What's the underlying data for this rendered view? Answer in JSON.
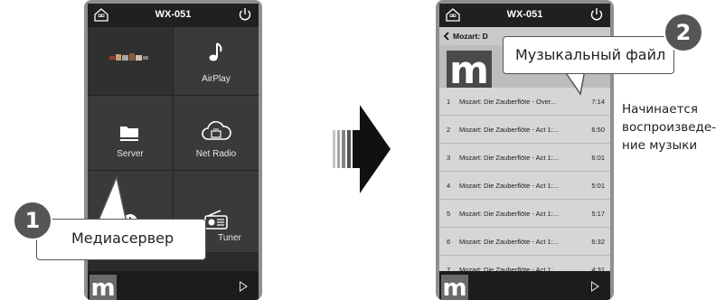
{
  "phone1": {
    "title": "WX-051",
    "home_label": "Rooms",
    "tiles": [
      {
        "label": ""
      },
      {
        "label": "AirPlay"
      },
      {
        "label": "Server"
      },
      {
        "label": "Net Radio"
      },
      {
        "label": ""
      },
      {
        "label": "Tuner"
      }
    ]
  },
  "phone2": {
    "title": "WX-051",
    "home_label": "Rooms",
    "back_label": "Mozart: D",
    "tracks": [
      {
        "num": "1",
        "title": "Mozart: Die Zauberflöte - Over...",
        "duration": "7:14"
      },
      {
        "num": "2",
        "title": "Mozart: Die Zauberflöte - Act 1:...",
        "duration": "6:50"
      },
      {
        "num": "3",
        "title": "Mozart: Die Zauberflöte - Act 1:...",
        "duration": "6:01"
      },
      {
        "num": "4",
        "title": "Mozart: Die Zauberflöte - Act 1:...",
        "duration": "5:01"
      },
      {
        "num": "5",
        "title": "Mozart: Die Zauberflöte - Act 1:...",
        "duration": "5:17"
      },
      {
        "num": "6",
        "title": "Mozart: Die Zauberflöte - Act 1:...",
        "duration": "6:32"
      },
      {
        "num": "7",
        "title": "Mozart: Die Zauberflöte - Act 1:...",
        "duration": "4:31"
      }
    ]
  },
  "callout1": {
    "number": "1",
    "text": "Медиасервер"
  },
  "callout2": {
    "number": "2",
    "text": "Музыкальный файл"
  },
  "note": {
    "lines": [
      "Начинается",
      "воспроизведе-",
      "ние музыки"
    ]
  },
  "logo_letter": "m",
  "colors": {
    "phone_frame": "#8f8f8f",
    "screen": "#2b2b2b",
    "badge": "#555555",
    "arrow": "#111111"
  }
}
